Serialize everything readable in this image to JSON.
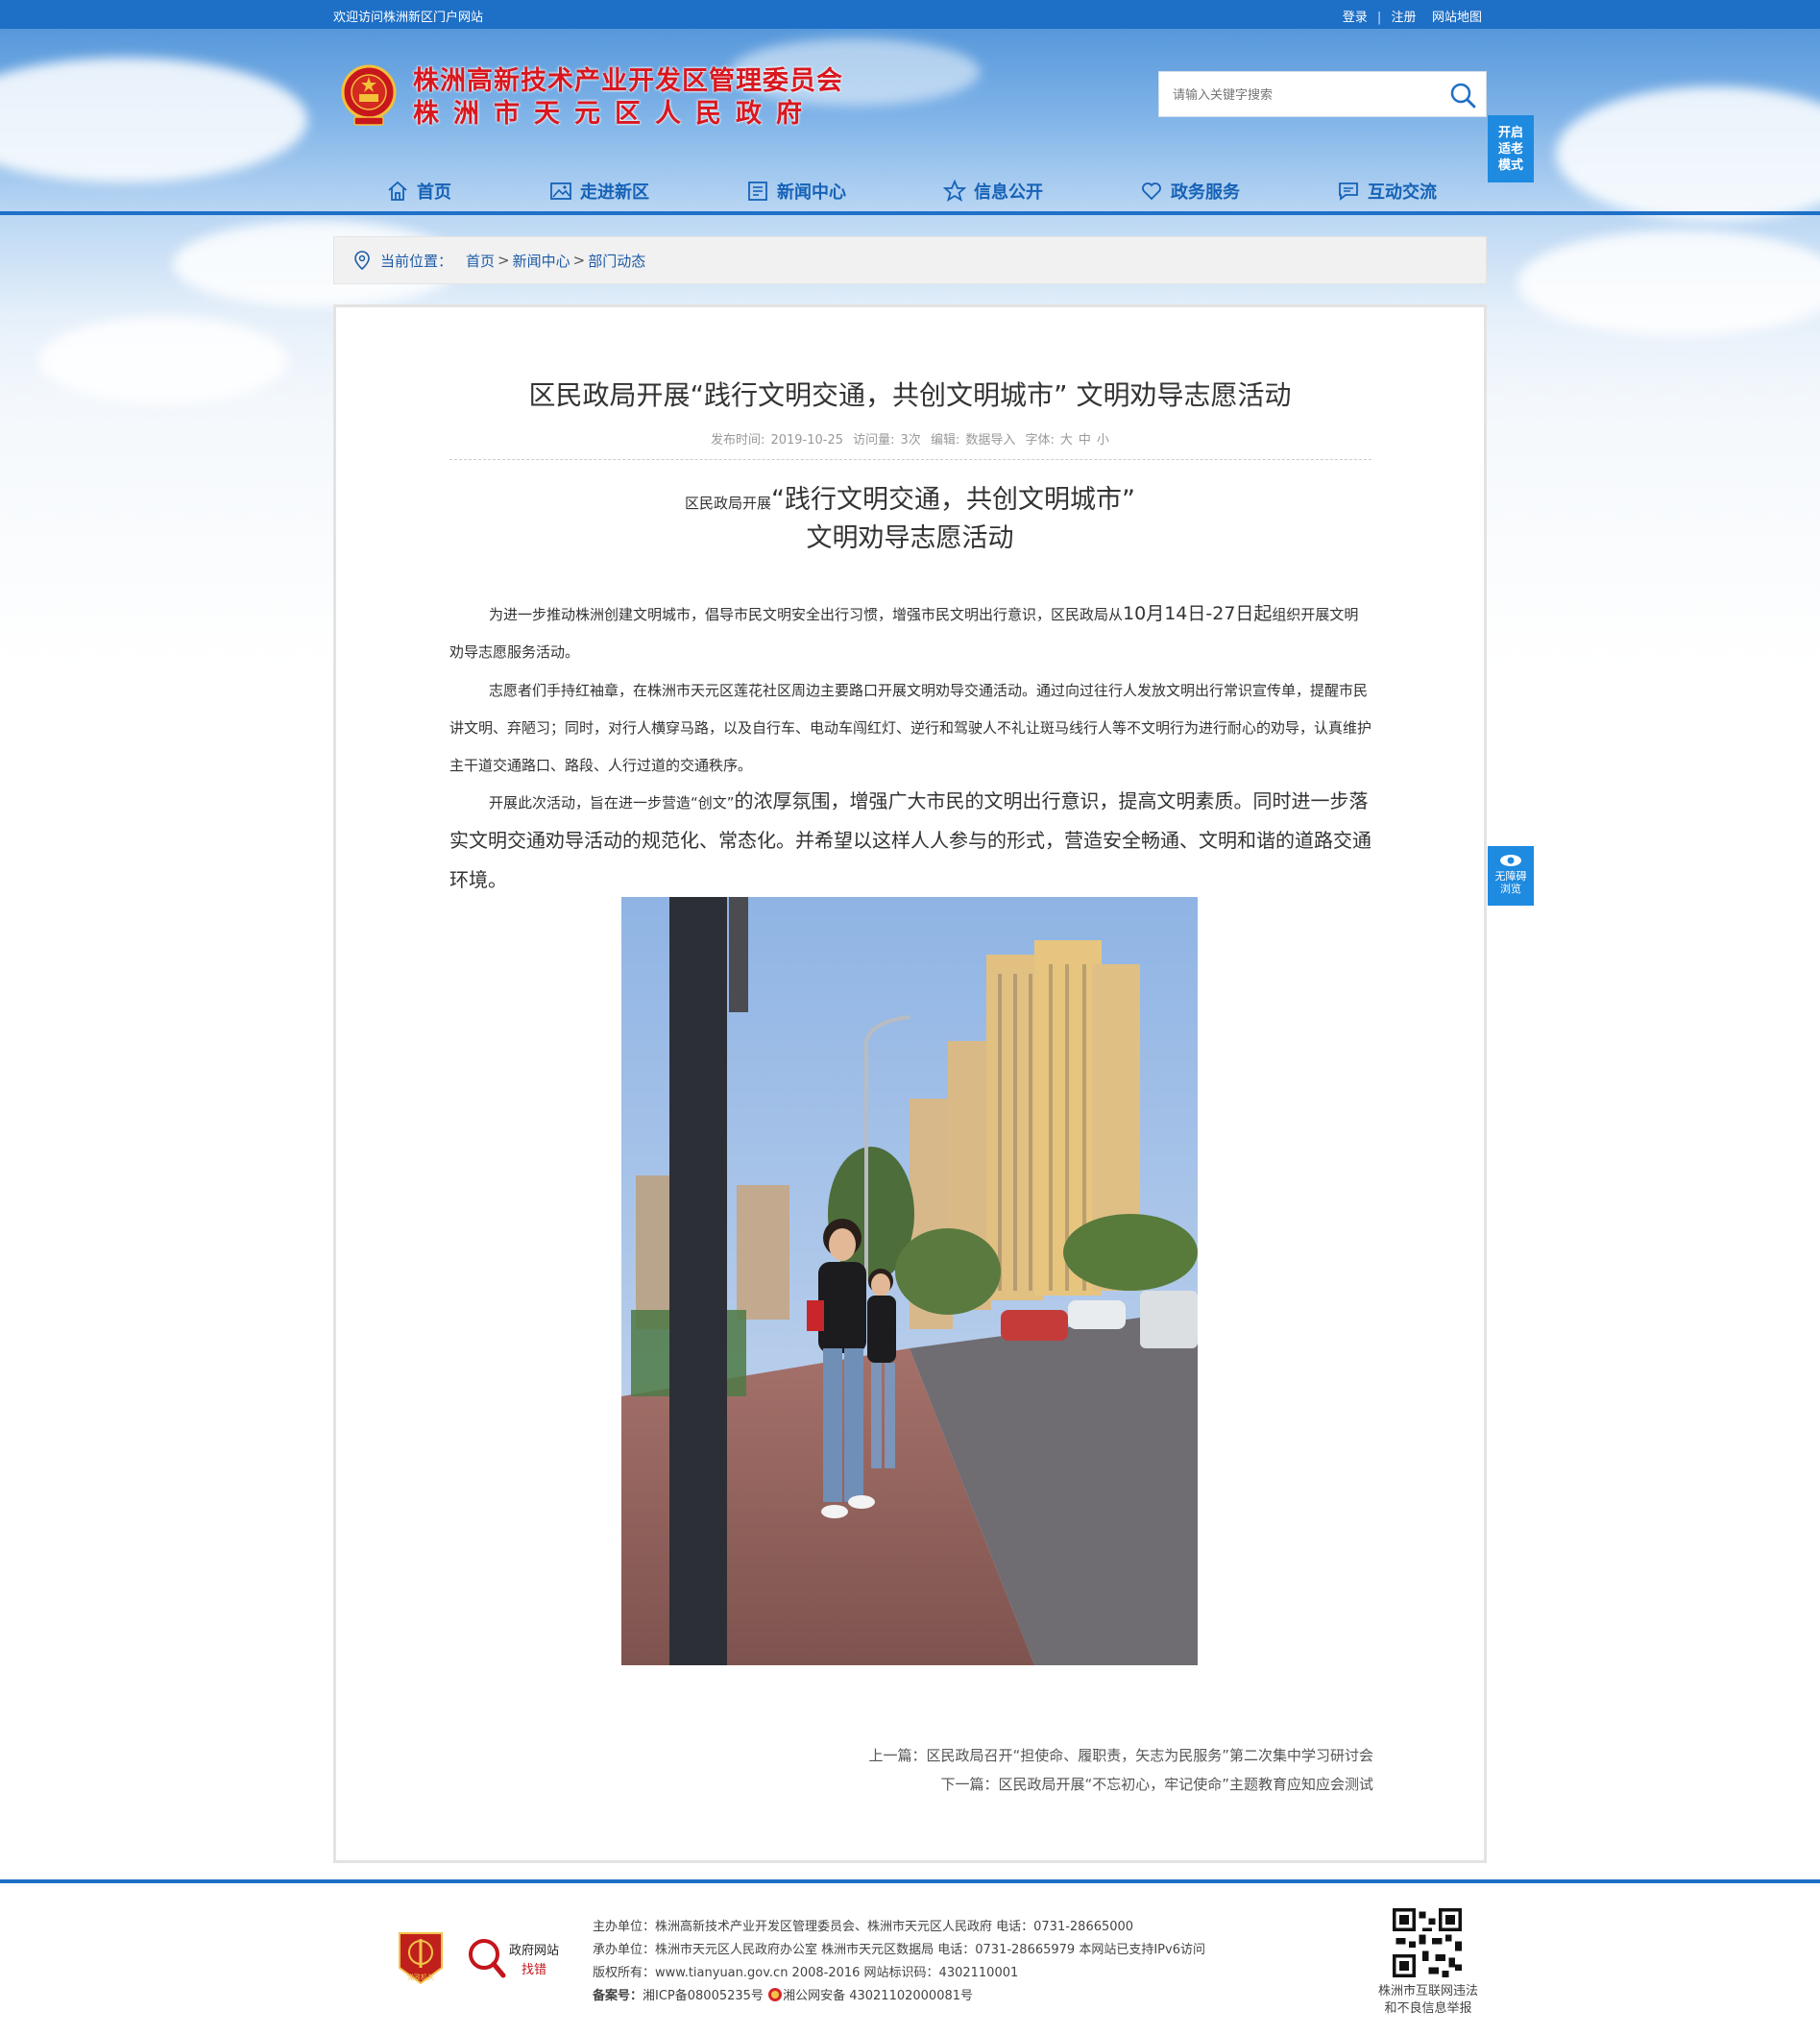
{
  "topbar": {
    "welcome": "欢迎访问株洲新区门户网站",
    "login": "登录",
    "register": "注册",
    "sitemap": "网站地图",
    "sep": "|"
  },
  "header": {
    "title_line1": "株洲高新技术产业开发区管理委员会",
    "title_line2": "株洲市天元区人民政府",
    "search_placeholder": "请输入关键字搜索",
    "elder_mode": [
      "开启",
      "适老",
      "模式"
    ]
  },
  "nav": {
    "items": [
      {
        "label": "首页",
        "icon": "home-icon"
      },
      {
        "label": "走进新区",
        "icon": "picture-icon"
      },
      {
        "label": "新闻中心",
        "icon": "news-icon"
      },
      {
        "label": "信息公开",
        "icon": "star-icon"
      },
      {
        "label": "政务服务",
        "icon": "heart-icon"
      },
      {
        "label": "互动交流",
        "icon": "chat-icon"
      }
    ]
  },
  "breadcrumb": {
    "label": "当前位置：",
    "items": [
      "首页",
      "新闻中心",
      "部门动态"
    ],
    "sep": ">"
  },
  "article": {
    "title": "区民政局开展“践行文明交通，共创文明城市” 文明劝导志愿活动",
    "meta": {
      "date_label": "发布时间:",
      "date": "2019-10-25",
      "views_label": "访问量:",
      "views": "3次",
      "editor_label": "编辑:",
      "editor": "数据导入",
      "font_label": "字体:",
      "font_sizes": [
        "大",
        "中",
        "小"
      ]
    },
    "subtitle_small": "区民政局开展",
    "subtitle_big": "“践行文明交通，共创文明城市”",
    "subtitle_line2": "文明劝导志愿活动",
    "p1_a": "为进一步推动株洲创建文明城市，倡导市民文明安全出行习惯，增强市民文明出行意识，区民政局从",
    "p1_b": "10月14日-27日起",
    "p1_c": "组织开展文明劝导志愿服务活动。",
    "p2": "志愿者们手持红袖章，在株洲市天元区莲花社区周边主要路口开展文明劝导交通活动。通过向过往行人发放文明出行常识宣传单，提醒市民讲文明、弃陋习；同时，对行人横穿马路，以及自行车、电动车闯红灯、逆行和驾驶人不礼让斑马线行人等不文明行为进行耐心的劝导，认真维护主干道交通路口、路段、人行过道的交通秩序。",
    "p3_a": "开展此次活动，旨在进一步营造“创文”",
    "p3_b": "的浓厚氛围，增强广大市民的文明出行意识，提高文明素质。同时进一步落实文明交通劝导活动的规范化、常态化。并希望以这样人人参与的形式，营造安全畅通、文明和谐的道路交通环境。",
    "prev": "上一篇：区民政局召开“担使命、履职责，矢志为民服务”第二次集中学习研讨会",
    "next": "下一篇：区民政局开展“不忘初心，牢记使命”主题教育应知应会测试"
  },
  "accessibility": [
    "无障碍",
    "浏览"
  ],
  "footer": {
    "host": "主办单位：株洲高新技术产业开发区管理委员会、株洲市天元区人民政府 电话：0731-28665000",
    "organizer": "承办单位：株洲市天元区人民政府办公室 株洲市天元区数据局 电话：0731-28665979 本网站已支持IPv6访问",
    "copyright": "版权所有：www.tianyuan.gov.cn 2008-2016 网站标识码：4302110001",
    "record_label": "备案号：",
    "icp": "湘ICP备08005235号",
    "police": "湘公网安备 43021102000081号",
    "badge1_text": "党政机关",
    "badge2_line1": "政府网站",
    "badge2_line2": "找错",
    "qr_caption_line1": "株洲市互联网违法",
    "qr_caption_line2": "和不良信息举报"
  },
  "colors": {
    "brand_blue": "#1e6fc6",
    "title_red": "#d9171f",
    "nav_text": "#1662b6"
  }
}
